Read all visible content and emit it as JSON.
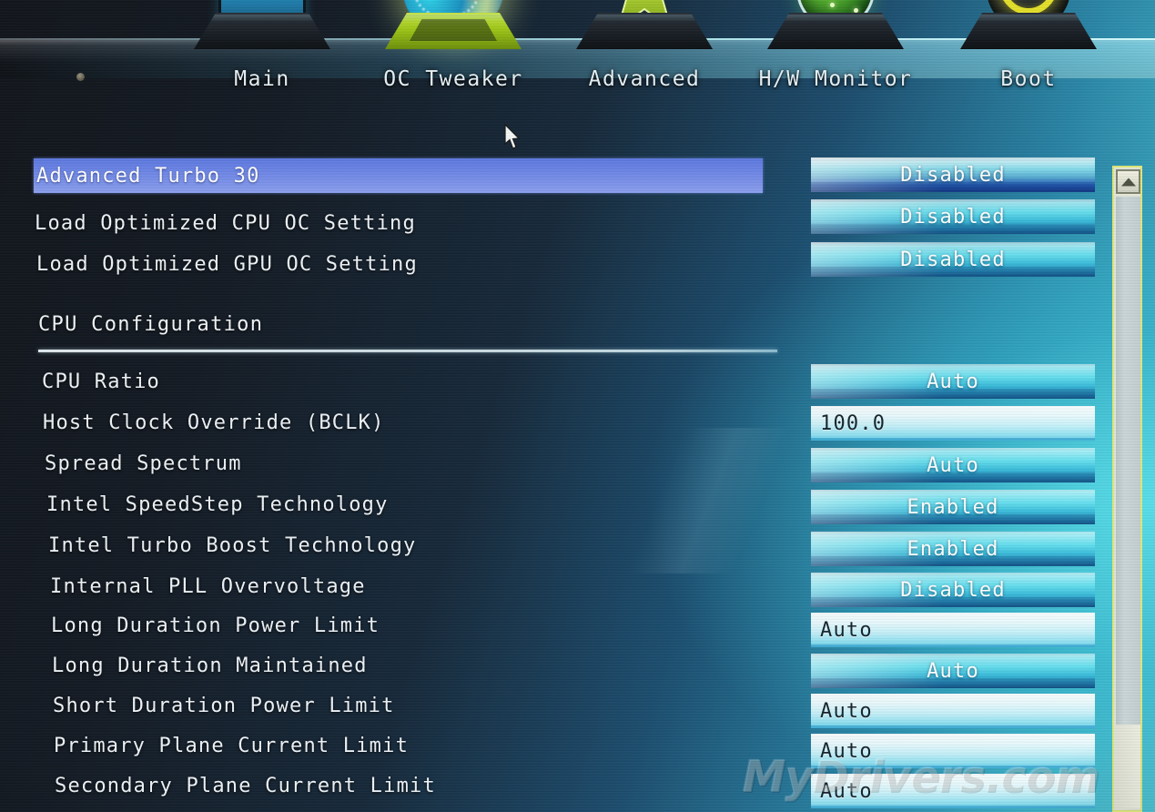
{
  "nav": {
    "tabs": [
      {
        "label": "Main",
        "icon": "monitor-icon",
        "active": false
      },
      {
        "label": "OC Tweaker",
        "icon": "overclock-orb-icon",
        "active": true
      },
      {
        "label": "Advanced",
        "icon": "star-icon",
        "active": false
      },
      {
        "label": "H/W Monitor",
        "icon": "gauge-sphere-icon",
        "active": false
      },
      {
        "label": "Boot",
        "icon": "power-ring-icon",
        "active": false
      }
    ]
  },
  "section": {
    "heading": "CPU Configuration"
  },
  "settings": [
    {
      "label": "Advanced Turbo 30",
      "value": "Disabled",
      "control": "combo",
      "selected": true
    },
    {
      "label": "Load Optimized CPU OC Setting",
      "value": "Disabled",
      "control": "combo",
      "selected": false
    },
    {
      "label": "Load Optimized GPU OC Setting",
      "value": "Disabled",
      "control": "combo",
      "selected": false
    },
    {
      "label": "CPU Ratio",
      "value": "Auto",
      "control": "combo",
      "selected": false
    },
    {
      "label": "Host Clock Override (BCLK)",
      "value": "100.0",
      "control": "entry",
      "selected": false
    },
    {
      "label": "Spread Spectrum",
      "value": "Auto",
      "control": "combo",
      "selected": false
    },
    {
      "label": "Intel SpeedStep Technology",
      "value": "Enabled",
      "control": "combo",
      "selected": false
    },
    {
      "label": "Intel Turbo Boost Technology",
      "value": "Enabled",
      "control": "combo",
      "selected": false
    },
    {
      "label": "Internal PLL Overvoltage",
      "value": "Disabled",
      "control": "combo",
      "selected": false
    },
    {
      "label": "Long Duration Power Limit",
      "value": "Auto",
      "control": "entry",
      "selected": false
    },
    {
      "label": "Long Duration Maintained",
      "value": "Auto",
      "control": "combo",
      "selected": false
    },
    {
      "label": "Short Duration Power Limit",
      "value": "Auto",
      "control": "entry",
      "selected": false
    },
    {
      "label": "Primary Plane Current Limit",
      "value": "Auto",
      "control": "entry",
      "selected": false
    },
    {
      "label": "Secondary Plane Current Limit",
      "value": "Auto",
      "control": "entry",
      "selected": false
    }
  ],
  "scrollbar": {
    "up_arrow": "▲",
    "position_percent": 0
  },
  "watermark": {
    "text": "MyDrivers.com"
  },
  "colors": {
    "selection_blue": "#7f95ea",
    "plate_cyan": "#68e1f0",
    "active_tab_green": "#c9e64a",
    "boot_ring_yellow": "#e3e02a",
    "text_light": "#eef4f8",
    "scrollbar_frame": "#dfe87a"
  }
}
